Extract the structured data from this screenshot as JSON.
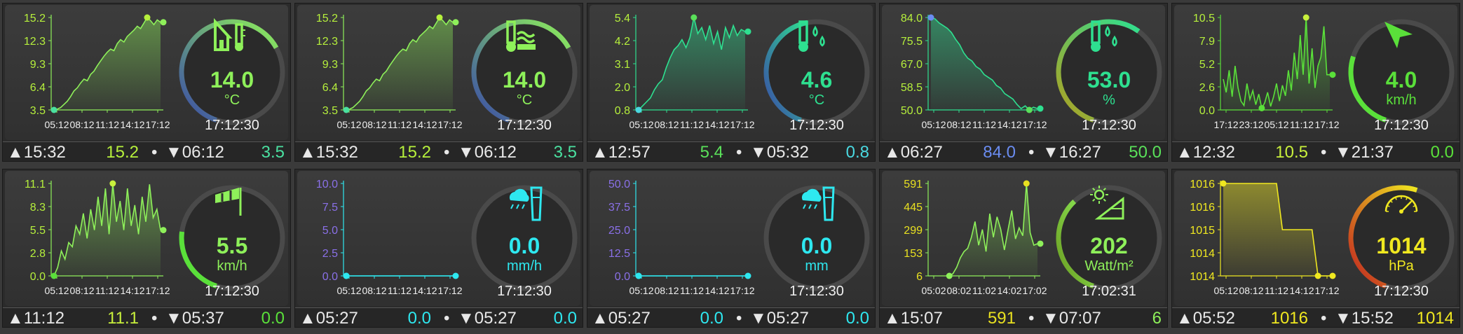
{
  "tiles": [
    {
      "id": "outdoor-temp",
      "color": "#8ef05a",
      "unit": "°C",
      "value": "14.0",
      "time": "17:12:30",
      "icon": "house-thermometer-icon",
      "ticks_y": [
        "15.2",
        "12.3",
        "9.3",
        "6.4",
        "3.5"
      ],
      "ticks_x": [
        "05:12",
        "08:12",
        "11:12",
        "14:12",
        "17:12"
      ],
      "gauge_level": 0.62,
      "gauge_gradient": [
        "#3a4aa8",
        "#8ef05a"
      ],
      "max_time": "▲15:32",
      "max_val": "15.2",
      "min_time": "▼06:12",
      "min_val": "3.5",
      "max_color": "#b6f03c",
      "min_color": "#4ae0a0",
      "series": [
        3.5,
        3.6,
        3.8,
        4.2,
        4.6,
        5.2,
        5.9,
        6.3,
        6.9,
        7.4,
        7.2,
        8.0,
        8.4,
        9.1,
        9.7,
        10.3,
        10.8,
        11.2,
        11.0,
        11.9,
        12.4,
        12.1,
        12.8,
        13.2,
        13.6,
        14.1,
        13.8,
        14.5,
        15.2,
        14.8,
        14.3,
        14.9,
        14.6
      ]
    },
    {
      "id": "greenhouse-temp",
      "color": "#8ef05a",
      "unit": "°C",
      "value": "14.0",
      "time": "17:12:30",
      "icon": "thermometer-heater-icon",
      "ticks_y": [
        "15.2",
        "12.3",
        "9.3",
        "6.4",
        "3.5"
      ],
      "ticks_x": [
        "05:12",
        "08:12",
        "11:12",
        "14:12",
        "17:12"
      ],
      "gauge_level": 0.62,
      "gauge_gradient": [
        "#3a4aa8",
        "#8ef05a"
      ],
      "max_time": "▲15:32",
      "max_val": "15.2",
      "min_time": "▼06:12",
      "min_val": "3.5",
      "max_color": "#b6f03c",
      "min_color": "#4ae0a0",
      "series": [
        3.5,
        3.6,
        3.8,
        4.2,
        4.6,
        5.2,
        5.9,
        6.3,
        6.9,
        7.4,
        7.2,
        8.0,
        8.4,
        9.1,
        9.7,
        10.3,
        10.8,
        11.2,
        11.0,
        11.9,
        12.4,
        12.1,
        12.8,
        13.2,
        13.6,
        14.1,
        13.8,
        14.5,
        15.2,
        14.8,
        14.3,
        14.9,
        14.6
      ]
    },
    {
      "id": "dewpoint",
      "color": "#2ee090",
      "unit": "°C",
      "value": "4.6",
      "time": "17:12:30",
      "icon": "thermometer-drops-icon",
      "ticks_y": [
        "5.4",
        "4.2",
        "3.1",
        "2.0",
        "0.8"
      ],
      "ticks_x": [
        "05:12",
        "08:12",
        "11:12",
        "14:12",
        "17:12"
      ],
      "gauge_level": 0.42,
      "gauge_gradient": [
        "#3a4aa8",
        "#2ee090"
      ],
      "max_time": "▲12:57",
      "max_val": "5.4",
      "min_time": "▼05:32",
      "min_val": "0.8",
      "max_color": "#5ae05a",
      "min_color": "#4ad8e0",
      "series": [
        0.8,
        1.0,
        1.2,
        1.4,
        1.8,
        2.1,
        2.3,
        2.9,
        3.4,
        3.8,
        4.0,
        4.3,
        3.9,
        4.4,
        5.4,
        4.6,
        4.9,
        4.3,
        5.0,
        4.1,
        4.7,
        3.8,
        4.9,
        4.4,
        5.0,
        4.5,
        4.8,
        4.7
      ]
    },
    {
      "id": "humidity",
      "color": "#2ee090",
      "unit": "%",
      "value": "53.0",
      "time": "17:12:30",
      "icon": "thermometer-drops-icon",
      "ticks_y": [
        "84.0",
        "75.5",
        "67.0",
        "58.5",
        "50.0"
      ],
      "ticks_x": [
        "05:12",
        "08:12",
        "11:12",
        "14:12",
        "17:12"
      ],
      "gauge_level": 0.55,
      "gauge_gradient": [
        "#b0a020",
        "#2ee090"
      ],
      "max_time": "▲06:27",
      "max_val": "84.0",
      "min_time": "▼16:27",
      "min_val": "50.0",
      "max_color": "#6a8cf0",
      "min_color": "#5ae05a",
      "series": [
        84.0,
        83.5,
        82.0,
        81.0,
        80.0,
        78.5,
        76.0,
        74.0,
        71.0,
        69.0,
        68.0,
        66.0,
        65.0,
        63.0,
        62.0,
        61.0,
        59.0,
        58.0,
        56.0,
        55.0,
        54.0,
        52.0,
        50.5,
        51.5,
        50.0,
        51.0,
        50.5
      ]
    },
    {
      "id": "wind-direction",
      "color": "#5ae03a",
      "unit": "km/h",
      "value": "4.0",
      "time": "17:12:30",
      "icon": "wind-arrow-icon",
      "ticks_y": [
        "10.5",
        "7.9",
        "5.2",
        "2.6",
        "0.0"
      ],
      "ticks_x": [
        "17:12",
        "23:12",
        "05:12",
        "11:12",
        "17:12"
      ],
      "gauge_level": 0.25,
      "gauge_gradient": [
        "#5ae03a",
        "#5ae03a"
      ],
      "max_time": "▲12:32",
      "max_val": "10.5",
      "min_time": "▼21:37",
      "min_val": "0.0",
      "max_color": "#c8f03c",
      "min_color": "#5ae03a",
      "series": [
        3.5,
        2.0,
        4.5,
        1.5,
        5.0,
        2.5,
        1.0,
        0.5,
        3.0,
        1.2,
        2.2,
        0.6,
        1.8,
        0.2,
        0.8,
        2.0,
        0.4,
        1.5,
        3.0,
        1.0,
        2.8,
        1.6,
        4.5,
        2.2,
        6.5,
        3.5,
        8.5,
        4.0,
        10.5,
        3.0,
        7.0,
        2.5,
        5.0,
        6.0,
        9.5,
        4.0,
        4.0
      ]
    },
    {
      "id": "wind-speed",
      "color": "#8ef05a",
      "unit": "km/h",
      "value": "5.5",
      "time": "17:12:30",
      "icon": "windsock-icon",
      "ticks_y": [
        "11.1",
        "8.3",
        "5.5",
        "2.8",
        "0.0"
      ],
      "ticks_x": [
        "05:12",
        "08:12",
        "11:12",
        "14:12",
        "17:12"
      ],
      "gauge_level": 0.22,
      "gauge_gradient": [
        "#5ae03a",
        "#5ae03a"
      ],
      "max_time": "▲11:12",
      "max_val": "11.1",
      "min_time": "▼05:37",
      "min_val": "0.0",
      "max_color": "#c8f03c",
      "min_color": "#5ae03a",
      "series": [
        0.0,
        1.0,
        3.0,
        2.0,
        4.0,
        3.5,
        6.0,
        5.0,
        7.5,
        4.5,
        8.0,
        5.5,
        9.5,
        6.0,
        10.5,
        5.0,
        11.1,
        6.5,
        9.0,
        5.5,
        10.5,
        6.0,
        8.5,
        5.0,
        9.5,
        6.5,
        11.0,
        7.0,
        8.0,
        5.5
      ]
    },
    {
      "id": "rain-rate",
      "color": "#2ee8f0",
      "unit": "mm/h",
      "value": "0.0",
      "time": "17:12:30",
      "icon": "rain-cloud-gauge-icon",
      "ticks_y": [
        "10.0",
        "7.5",
        "5.0",
        "2.5",
        "0.0"
      ],
      "ticks_x": [
        "05:12",
        "08:12",
        "11:12",
        "14:12",
        "17:12"
      ],
      "gauge_level": 0,
      "gauge_gradient": [
        "#2ee8f0",
        "#2ee8f0"
      ],
      "max_time": "▲05:27",
      "max_val": "0.0",
      "min_time": "▼05:27",
      "min_val": "0.0",
      "max_color": "#2ee8f0",
      "min_color": "#2ee8f0",
      "tick_color": "#8a70e8",
      "series": [
        0,
        0
      ]
    },
    {
      "id": "rain-total",
      "color": "#2ee8f0",
      "unit": "mm",
      "value": "0.0",
      "time": "17:12:30",
      "icon": "rain-cloud-gauge-icon",
      "ticks_y": [
        "50.0",
        "37.5",
        "25.0",
        "12.5",
        "0.0"
      ],
      "ticks_x": [
        "05:12",
        "08:12",
        "11:12",
        "14:12",
        "17:12"
      ],
      "gauge_level": 0,
      "gauge_gradient": [
        "#2ee8f0",
        "#2ee8f0"
      ],
      "max_time": "▲05:27",
      "max_val": "0.0",
      "min_time": "▼05:27",
      "min_val": "0.0",
      "max_color": "#2ee8f0",
      "min_color": "#2ee8f0",
      "tick_color": "#8a70e8",
      "series": [
        0,
        0
      ]
    },
    {
      "id": "solar-radiation",
      "color": "#8ef05a",
      "unit": "Watt/m²",
      "value": "202",
      "time": "17:02:31",
      "icon": "sun-panel-icon",
      "ticks_y": [
        "591",
        "445",
        "299",
        "153",
        "6"
      ],
      "ticks_x": [
        "05:02",
        "08:02",
        "11:02",
        "14:02",
        "17:02"
      ],
      "gauge_level": 0.33,
      "gauge_gradient": [
        "#6a9a20",
        "#8ef05a"
      ],
      "max_time": "▲15:07",
      "max_val": "591",
      "min_time": "▼07:07",
      "min_val": "6",
      "max_color": "#e8e020",
      "min_color": "#8ef05a",
      "tick_color": "#e8e020",
      "series": [
        null,
        null,
        null,
        null,
        null,
        6,
        20,
        60,
        120,
        160,
        180,
        250,
        350,
        200,
        300,
        160,
        400,
        250,
        380,
        300,
        170,
        300,
        420,
        240,
        310,
        260,
        591,
        280,
        200,
        210
      ]
    },
    {
      "id": "pressure",
      "color": "#f0e820",
      "unit": "hPa",
      "value": "1014",
      "time": "17:12:30",
      "icon": "barometer-icon",
      "ticks_y": [
        "1016",
        "1016",
        "1015",
        "1014",
        "1014"
      ],
      "ticks_x": [
        "05:12",
        "08:12",
        "11:12",
        "14:12",
        "17:12"
      ],
      "gauge_level": 0.5,
      "gauge_gradient": [
        "#c02020",
        "#f0e820"
      ],
      "max_time": "▲05:52",
      "max_val": "1016",
      "min_time": "▼15:52",
      "min_val": "1014",
      "max_color": "#f0e820",
      "min_color": "#f0e820",
      "tick_color": "#f0e820",
      "series": [
        1016,
        1016,
        1016,
        1016,
        1016,
        1016,
        1016,
        1016,
        1016,
        1016,
        1015,
        1015,
        1015,
        1015,
        1015,
        1015,
        1014,
        1014,
        1014
      ]
    }
  ]
}
